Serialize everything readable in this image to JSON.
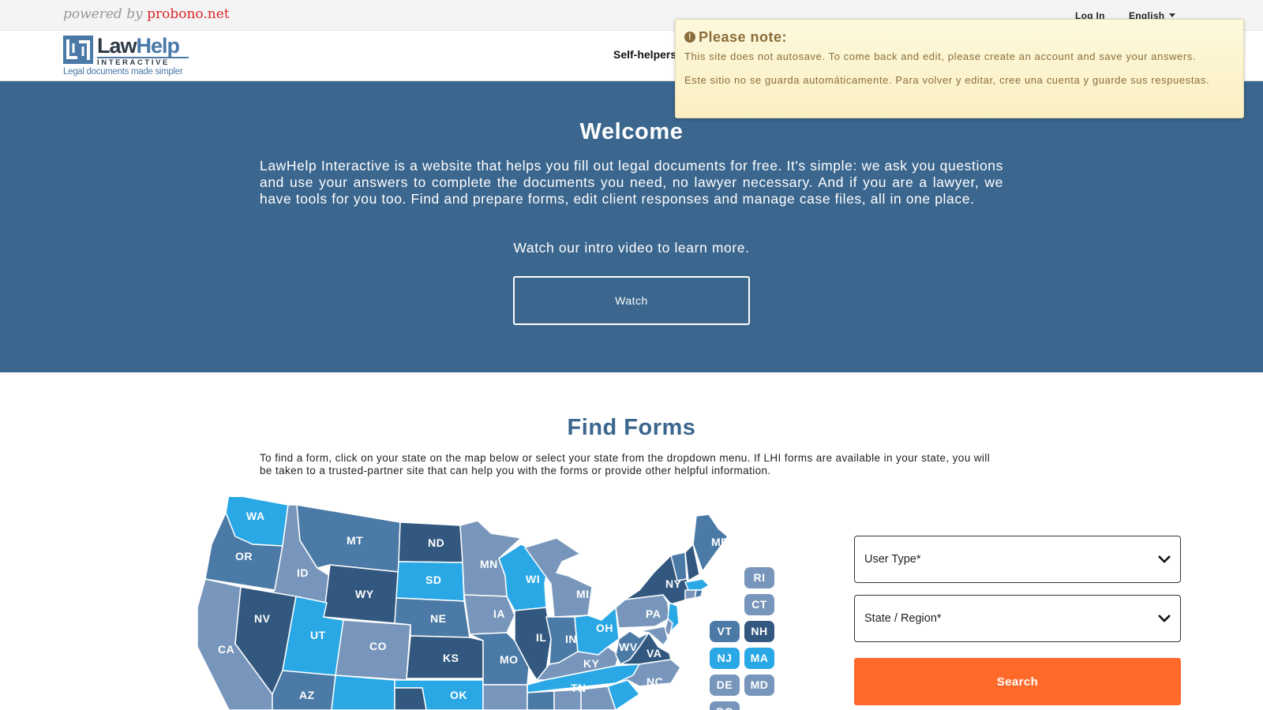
{
  "topbar": {
    "powered_by": "powered by",
    "brand": "probono.net",
    "login": "Log In",
    "language": "English"
  },
  "header": {
    "logo_law": "Law",
    "logo_help": "Help",
    "logo_interactive": "INTERACTIVE",
    "logo_tagline": "Legal documents made simpler",
    "nav_self_helpers": "Self-helpers"
  },
  "hero": {
    "title": "Welcome",
    "text": "LawHelp Interactive is a website that helps you fill out legal documents for free. It's simple: we ask you questions and use your answers to complete the documents you need, no lawyer necessary. And if you are a lawyer, we have tools for you too. Find and prepare forms, edit client responses and manage case files, all in one place.",
    "video_text": "Watch our intro video to learn more.",
    "watch_label": "Watch"
  },
  "find_forms": {
    "title": "Find Forms",
    "description": "To find a form, click on your state on the map below or select your state from the dropdown menu. If LHI forms are available in your state, you will be taken to a trusted-partner site that can help you with the forms or provide other helpful information."
  },
  "map": {
    "states": [
      "WA",
      "OR",
      "CA",
      "ID",
      "NV",
      "MT",
      "WY",
      "UT",
      "AZ",
      "CO",
      "ND",
      "SD",
      "NE",
      "KS",
      "OK",
      "MN",
      "IA",
      "MO",
      "WI",
      "IL",
      "MI",
      "IN",
      "OH",
      "KY",
      "TN",
      "WV",
      "VA",
      "NC",
      "PA",
      "NY",
      "ME"
    ],
    "small_states": [
      "RI",
      "CT",
      "VT",
      "NH",
      "NJ",
      "MA",
      "DE",
      "MD",
      "DC"
    ],
    "colors": {
      "light": "#7896bb",
      "medium": "#4b7aa6",
      "dark": "#33587f",
      "bright": "#2aa8e6"
    }
  },
  "form": {
    "user_type": "User Type*",
    "state_region": "State / Region*",
    "search_label": "Search",
    "search_color": "#ff6a2b"
  },
  "notice": {
    "title": "Please note:",
    "line_en": "This site does not autosave. To come back and edit, please create an account and save your answers.",
    "line_es": "Este sitio no se guarda automáticamente. Para volver y editar, cree una cuenta y guarde sus respuestas."
  }
}
